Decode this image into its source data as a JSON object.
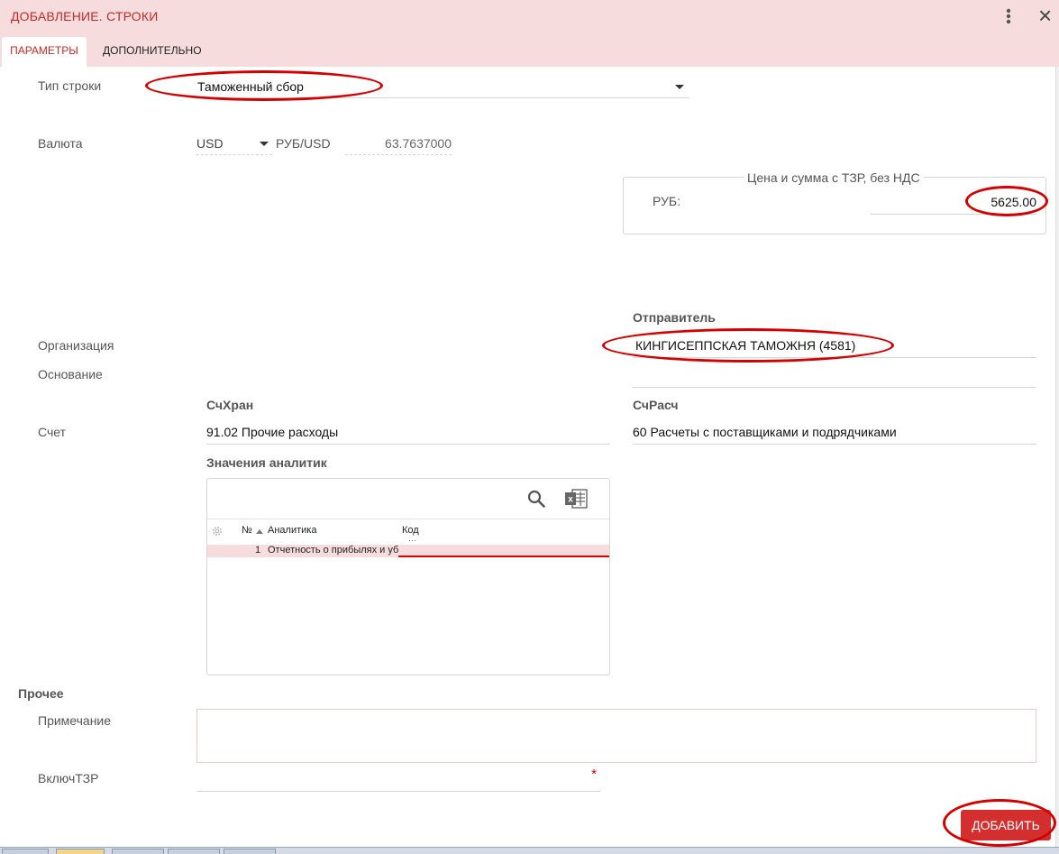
{
  "window": {
    "title": "ДОБАВЛЕНИЕ. СТРОКИ",
    "menu_icon": "vertical-dots-icon",
    "close_symbol": "×"
  },
  "tabs": [
    {
      "label": "ПАРАМЕТРЫ",
      "active": true
    },
    {
      "label": "ДОПОЛНИТЕЛЬНО",
      "active": false
    }
  ],
  "fields": {
    "row_type": {
      "label": "Тип строки",
      "value": "Таможенный сбор"
    },
    "currency": {
      "label": "Валюта",
      "value": "USD",
      "rate_label": "РУБ/USD",
      "rate_value": "63.7637000"
    },
    "price": {
      "legend": "Цена и сумма с ТЗР, без НДС",
      "label": "РУБ:",
      "value": "5625.00"
    },
    "sender": {
      "label": "Отправитель",
      "value": "КИНГИСЕППСКАЯ ТАМОЖНЯ (4581)"
    },
    "organization": {
      "label": "Организация"
    },
    "basis": {
      "label": "Основание"
    },
    "account": {
      "label": "Счет",
      "storage_label": "СчХран",
      "storage_value": "91.02 Прочие расходы",
      "settlement_label": "СчРасч",
      "settlement_value": "60 Расчеты с поставщиками и подрядчиками"
    }
  },
  "analytics": {
    "label": "Значения аналитик",
    "columns": [
      "№",
      "Аналитика",
      "Код"
    ],
    "rows": [
      {
        "num": "1",
        "name": "Отчетность о прибылях и убы",
        "code": ""
      }
    ]
  },
  "other": {
    "section_label": "Прочее",
    "note_label": "Примечание",
    "tzr_label": "ВключТЗР",
    "required_mark": "*"
  },
  "actions": {
    "add_label": "ДОБАВИТЬ"
  },
  "colors": {
    "header_bg": "#f6dcdc",
    "accent": "#c62828",
    "button_bg": "#d32f2f",
    "annotation": "#d50000"
  }
}
